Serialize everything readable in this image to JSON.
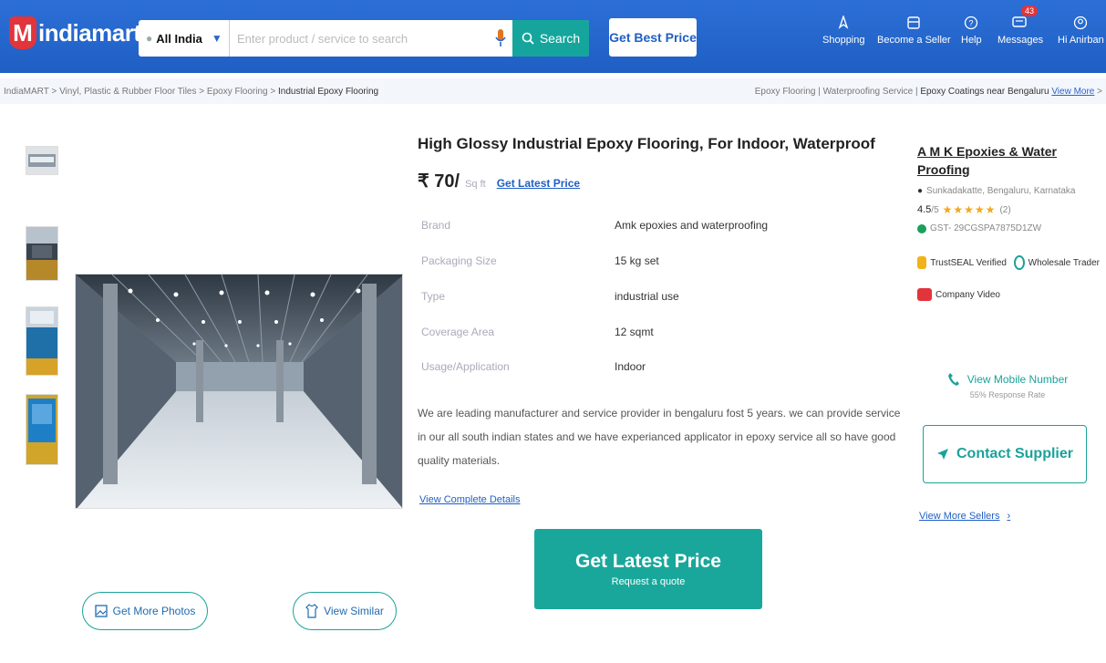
{
  "header": {
    "logo_mark": "M",
    "logo_text": "indiamart",
    "location": "All India",
    "search_placeholder": "Enter product / service to search",
    "search_button": "Search",
    "best_price_button": "Get Best Price",
    "nav": [
      {
        "label": "Shopping",
        "icon": "compass-icon"
      },
      {
        "label": "Become a Seller",
        "icon": "store-icon"
      },
      {
        "label": "Help",
        "icon": "help-icon"
      },
      {
        "label": "Messages",
        "icon": "messages-icon",
        "badge": "43"
      },
      {
        "label": "Hi Anirban",
        "icon": "user-icon"
      }
    ],
    "colors": {
      "header_blue": "#1f5fc4",
      "brand_red": "#e2343b",
      "teal": "#15a59c"
    }
  },
  "breadcrumb": {
    "items": [
      "IndiaMART",
      "Vinyl, Plastic & Rubber Floor Tiles",
      "Epoxy Flooring"
    ],
    "current": "Industrial Epoxy Flooring",
    "right_links": [
      "Epoxy Flooring",
      "Waterproofing Service"
    ],
    "right_bold": "Epoxy Coatings near Bengaluru",
    "view_more": "View More"
  },
  "product": {
    "title": "High Glossy Industrial Epoxy Flooring, For Indoor, Waterproof",
    "price": "₹ 70/",
    "unit": "Sq ft",
    "latest_price_link": "Get Latest Price",
    "specs": [
      {
        "key": "Brand",
        "value": "Amk epoxies and waterproofing"
      },
      {
        "key": "Packaging Size",
        "value": "15 kg set"
      },
      {
        "key": "Type",
        "value": "industrial use"
      },
      {
        "key": "Coverage Area",
        "value": "12 sqmt"
      },
      {
        "key": "Usage/Application",
        "value": "Indoor"
      }
    ],
    "description": "We are leading manufacturer and service provider in bengaluru fost 5 years. we can provide service in our all south indian states and we have experianced applicator in epoxy service all so have good quality materials.",
    "view_details": "View Complete Details",
    "cta_title": "Get Latest Price",
    "cta_sub": "Request a quote"
  },
  "gallery": {
    "more_photos": "Get More Photos",
    "view_similar": "View Similar"
  },
  "seller": {
    "name": "A M K Epoxies & Water Proofing",
    "location": "Sunkadakatte, Bengaluru, Karnataka",
    "rating": "4.5",
    "rating_scale": "/5",
    "rating_count": "(2)",
    "gst": "GST- 29CGSPA7875D1ZW",
    "trustseal": "TrustSEAL Verified",
    "trader": "Wholesale Trader",
    "video": "Company Video",
    "mobile": "View Mobile Number",
    "response_rate": "55% Response Rate",
    "contact": "Contact Supplier",
    "more_sellers": "View More Sellers"
  }
}
